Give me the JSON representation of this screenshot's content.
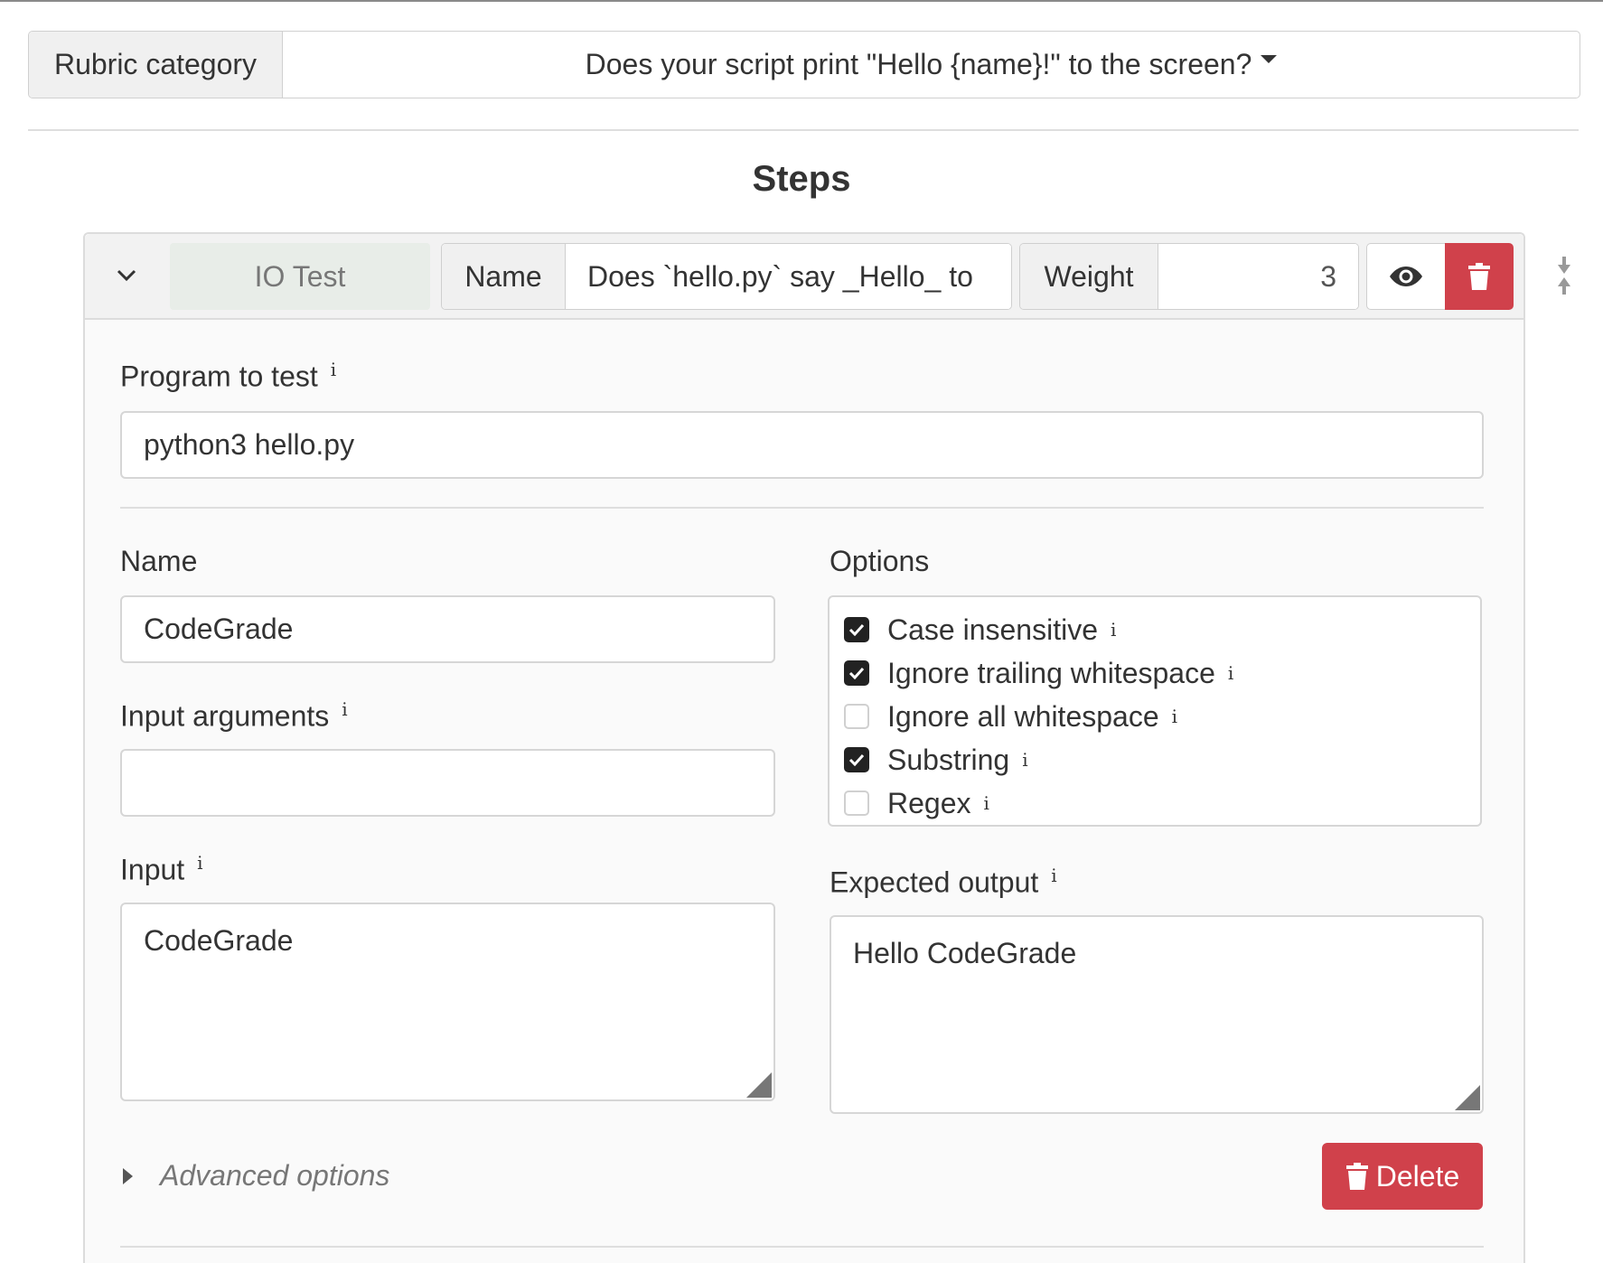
{
  "rubric": {
    "label": "Rubric category",
    "selected": "Does your script print \"Hello {name}!\" to the screen?"
  },
  "steps_title": "Steps",
  "step": {
    "type": "IO Test",
    "name_label": "Name",
    "name_value": "Does `hello.py` say _Hello_ to",
    "weight_label": "Weight",
    "weight_value": "3",
    "colors": {
      "danger": "#d0414b",
      "badge_bg": "#e8ede8"
    }
  },
  "program": {
    "label": "Program to test",
    "value": "python3 hello.py"
  },
  "case": {
    "name_label": "Name",
    "name_value": "CodeGrade",
    "args_label": "Input arguments",
    "args_value": "",
    "input_label": "Input",
    "input_value": "CodeGrade",
    "options_label": "Options",
    "options": [
      {
        "label": "Case insensitive",
        "checked": true
      },
      {
        "label": "Ignore trailing whitespace",
        "checked": true
      },
      {
        "label": "Ignore all whitespace",
        "checked": false
      },
      {
        "label": "Substring",
        "checked": true
      },
      {
        "label": "Regex",
        "checked": false
      }
    ],
    "expected_label": "Expected output",
    "expected_value": "Hello CodeGrade"
  },
  "advanced_label": "Advanced options",
  "delete_label": "Delete",
  "info_glyph": "i"
}
